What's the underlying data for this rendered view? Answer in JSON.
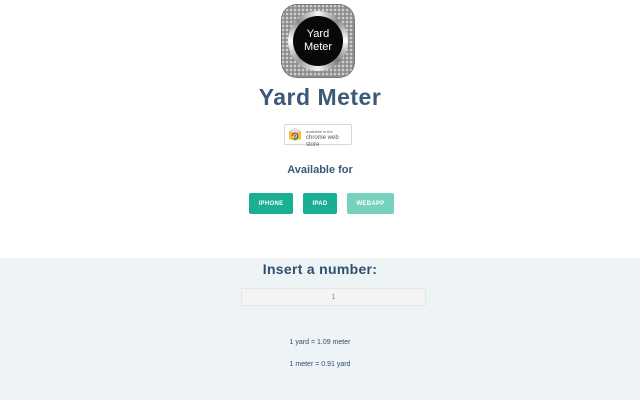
{
  "app": {
    "icon_text_line1": "Yard",
    "icon_text_line2": "Meter",
    "title": "Yard Meter"
  },
  "store_badge": {
    "small_text": "available in the",
    "name": "chrome web store"
  },
  "availability": {
    "label": "Available for",
    "platforms": [
      "IPHONE",
      "IPAD",
      "WEBAPP"
    ]
  },
  "converter": {
    "label": "Insert a number:",
    "input_value": "1",
    "result_yard": "1 yard = 1.09 meter",
    "result_meter": "1 meter = 0.91 yard"
  },
  "colors": {
    "title": "#3c5a78",
    "button": "#1aaf93",
    "button_light": "#76d2be",
    "lower_background": "#eef3f6"
  }
}
